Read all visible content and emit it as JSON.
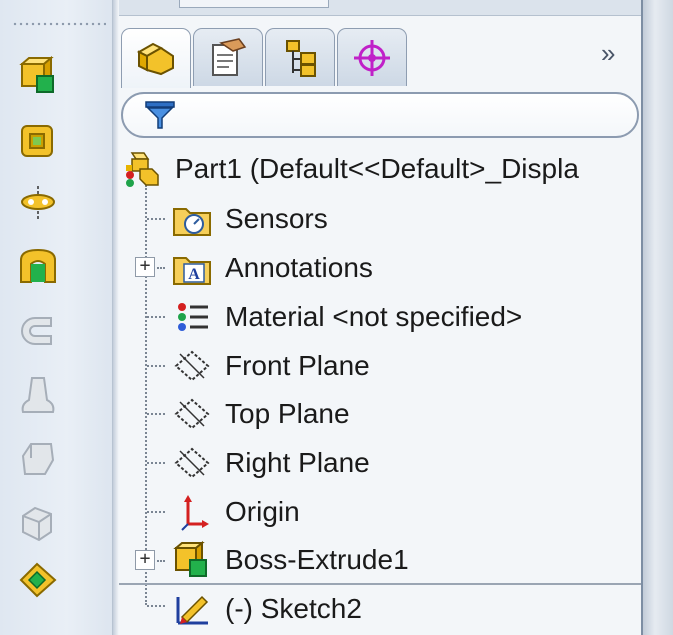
{
  "toolbar": {
    "tools": [
      {
        "icon": "extruded-boss-icon",
        "enabled": true
      },
      {
        "icon": "revolved-boss-icon",
        "enabled": true
      },
      {
        "icon": "swept-boss-icon",
        "enabled": true
      },
      {
        "icon": "lofted-boss-icon",
        "enabled": true
      },
      {
        "icon": "boundary-boss-icon",
        "enabled": false
      },
      {
        "icon": "extruded-cut-icon",
        "enabled": false
      },
      {
        "icon": "revolved-cut-icon",
        "enabled": false
      },
      {
        "icon": "swept-cut-icon",
        "enabled": false
      },
      {
        "icon": "lofted-cut-icon",
        "enabled": true
      }
    ]
  },
  "tabs": [
    {
      "icon": "feature-manager-icon",
      "active": true
    },
    {
      "icon": "property-manager-icon",
      "active": false
    },
    {
      "icon": "configuration-manager-icon",
      "active": false
    },
    {
      "icon": "dimxpert-manager-icon",
      "active": false
    }
  ],
  "more_label": "»",
  "filter": {
    "placeholder": "",
    "value": ""
  },
  "tree": {
    "root": "Part1  (Default<<Default>_Displa",
    "items": [
      {
        "label": "Sensors",
        "icon": "sensors-folder-icon",
        "expandable": false
      },
      {
        "label": "Annotations",
        "icon": "annotations-folder-icon",
        "expandable": true
      },
      {
        "label": "Material <not specified>",
        "icon": "material-icon",
        "expandable": false
      },
      {
        "label": "Front Plane",
        "icon": "plane-icon",
        "expandable": false
      },
      {
        "label": "Top Plane",
        "icon": "plane-icon",
        "expandable": false
      },
      {
        "label": "Right Plane",
        "icon": "plane-icon",
        "expandable": false
      },
      {
        "label": "Origin",
        "icon": "origin-icon",
        "expandable": false
      },
      {
        "label": "Boss-Extrude1",
        "icon": "boss-extrude-icon",
        "expandable": true
      },
      {
        "label": "(-) Sketch2",
        "icon": "sketch-icon",
        "expandable": false
      }
    ]
  },
  "colors": {
    "accent": "#e8b400",
    "active_green": "#1fa34a",
    "sketch_red": "#d42020"
  }
}
